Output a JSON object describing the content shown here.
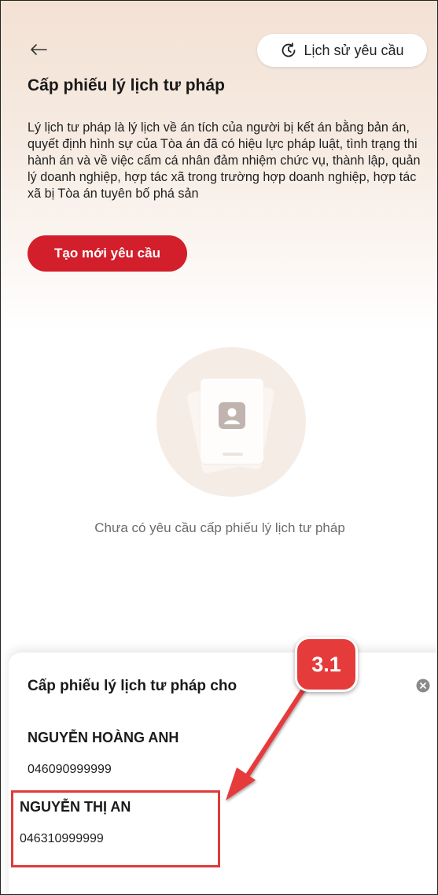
{
  "header": {
    "back_icon": "arrow-left-icon",
    "history_label": "Lịch sử yêu cầu",
    "history_icon": "history-clock-icon"
  },
  "page": {
    "title": "Cấp phiếu lý lịch tư pháp",
    "description": "Lý lịch tư pháp là lý lịch về án tích của người bị kết án bằng bản án, quyết định hình sự của Tòa án đã có hiệu lực pháp luật, tình trạng thi hành án và về việc cấm cá nhân đảm nhiệm chức vụ, thành lập, quản lý doanh nghiệp, hợp tác xã trong trường hợp doanh nghiệp, hợp tác xã bị Tòa án tuyên bố phá sản",
    "create_button": "Tạo mới yêu cầu",
    "empty_icon": "document-person-icon",
    "empty_text": "Chưa có yêu cầu cấp phiếu lý lịch tư pháp"
  },
  "sheet": {
    "title": "Cấp phiếu lý lịch tư pháp cho",
    "close_icon": "close-circle-icon",
    "people": [
      {
        "name": "NGUYỄN HOÀNG ANH",
        "id": "046090999999"
      },
      {
        "name": "NGUYỄN THỊ AN",
        "id": "046310999999"
      }
    ]
  },
  "annotation": {
    "step_label": "3.1",
    "color": "#e53b3b"
  },
  "colors": {
    "brand_red": "#d21f2b",
    "accent_annotation": "#e03a3a"
  }
}
